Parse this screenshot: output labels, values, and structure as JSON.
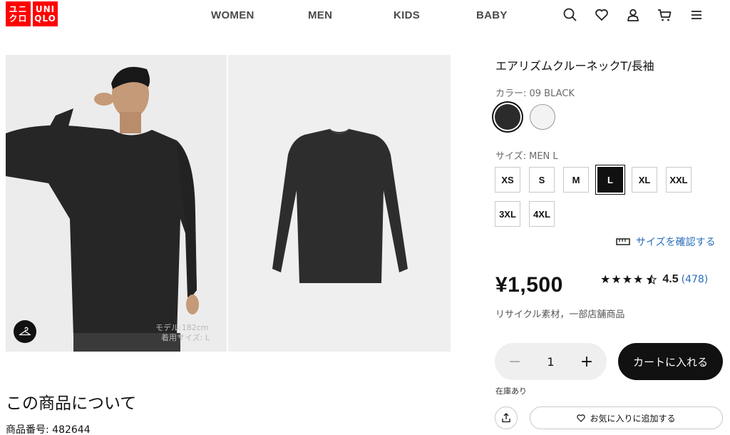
{
  "header": {
    "logo_top": "ユニ\nクロ",
    "logo_top_1": "ユニ",
    "logo_top_2": "クロ",
    "logo_right_1": "UNI",
    "logo_right_2": "QLO",
    "nav": [
      "WOMEN",
      "MEN",
      "KIDS",
      "BABY"
    ],
    "icons": [
      "search-icon",
      "heart-icon",
      "user-icon",
      "cart-icon",
      "menu-icon"
    ]
  },
  "gallery": {
    "model_caption_1": "モデル:182cm",
    "model_caption_2": "着用サイズ: L"
  },
  "about": {
    "title": "この商品について",
    "product_no": "商品番号: 482644"
  },
  "product": {
    "title": "エアリズムクルーネックT/長袖",
    "color_label": "カラー: 09 BLACK",
    "colors": [
      {
        "name": "BLACK",
        "hex": "#2b2b2b",
        "selected": true
      },
      {
        "name": "WHITE",
        "hex": "#f3f3f3",
        "selected": false
      }
    ],
    "size_label": "サイズ: MEN L",
    "sizes": [
      "XS",
      "S",
      "M",
      "L",
      "XL",
      "XXL",
      "3XL",
      "4XL"
    ],
    "selected_size": "L",
    "size_check": "サイズを確認する",
    "price": "¥1,500",
    "rating_stars": "★★★★",
    "rating_value": "4.5",
    "rating_count": "(478)",
    "recycle": "リサイクル素材，一部店舗商品",
    "quantity": "1",
    "cart_label": "カートに入れる",
    "stock": "在庫あり",
    "favorite_label": "お気に入りに追加する"
  },
  "colors": {
    "brand": "#ff0000",
    "link": "#2a6ebb",
    "primary_button": "#111111"
  }
}
